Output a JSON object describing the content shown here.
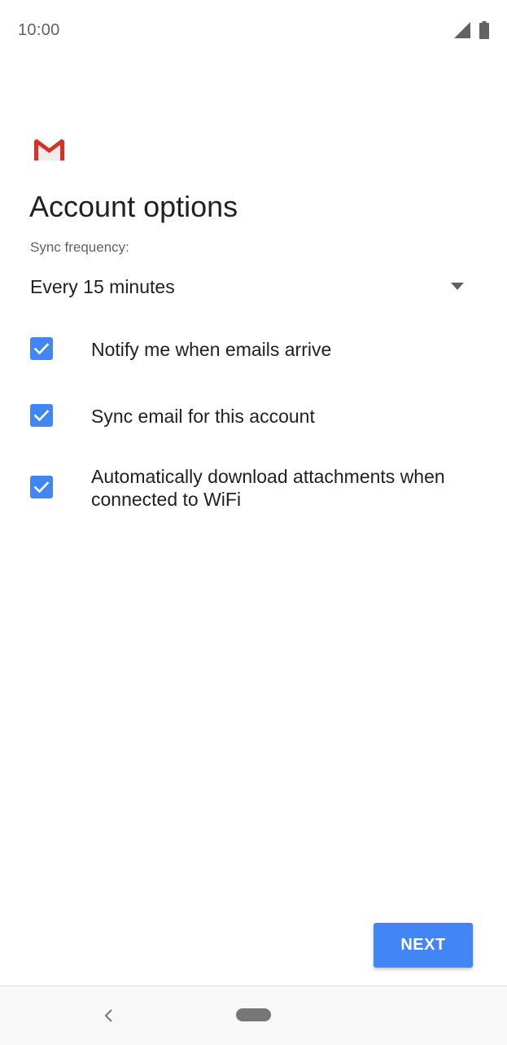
{
  "status_bar": {
    "time": "10:00",
    "signal_icon": "cell-signal-icon",
    "battery_icon": "battery-full-icon"
  },
  "header": {
    "logo_icon": "gmail-logo-icon",
    "title": "Account options"
  },
  "sync": {
    "label": "Sync frequency:",
    "selected_value": "Every 15 minutes",
    "dropdown_icon": "chevron-down-icon"
  },
  "options": [
    {
      "label": "Notify me when emails arrive",
      "checked": true
    },
    {
      "label": "Sync email for this account",
      "checked": true
    },
    {
      "label": "Automatically download attachments when connected to WiFi",
      "checked": true
    }
  ],
  "actions": {
    "next_label": "NEXT"
  },
  "nav_bar": {
    "back_icon": "back-chevron-icon",
    "home_icon": "home-pill-icon"
  },
  "colors": {
    "accent": "#4285f4",
    "text_primary": "#202124",
    "text_secondary": "#5f6368",
    "gmail_red": "#d93025"
  }
}
